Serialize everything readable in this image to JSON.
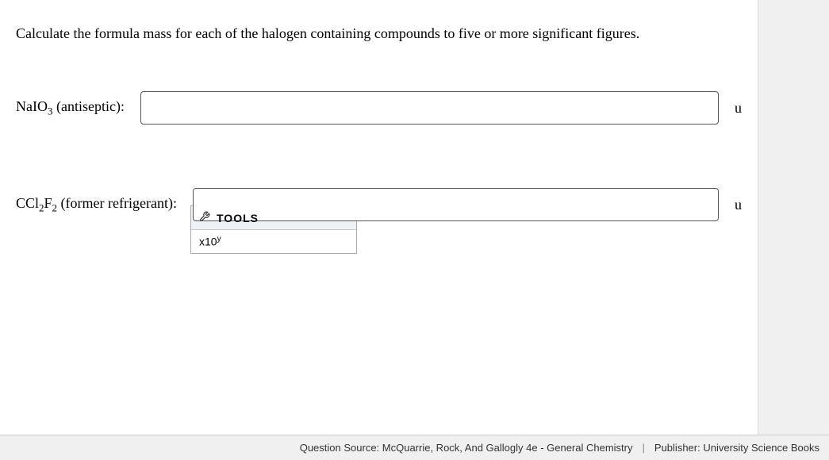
{
  "question": {
    "prompt": "Calculate the formula mass for each of the halogen containing compounds to five or more significant figures."
  },
  "inputs": [
    {
      "compound_html": "NaIO<sub>3</sub> (antiseptic):",
      "value": "",
      "unit": "u"
    },
    {
      "compound_html": "CCl<sub>2</sub>F<sub>2</sub> (former refrigerant):",
      "value": "",
      "unit": "u"
    }
  ],
  "tools": {
    "header": "TOOLS",
    "button_html": "x10<sup>y</sup>"
  },
  "footer": {
    "source": "Question Source: McQuarrie, Rock, And Gallogly 4e - General Chemistry",
    "publisher": "Publisher: University Science Books"
  }
}
